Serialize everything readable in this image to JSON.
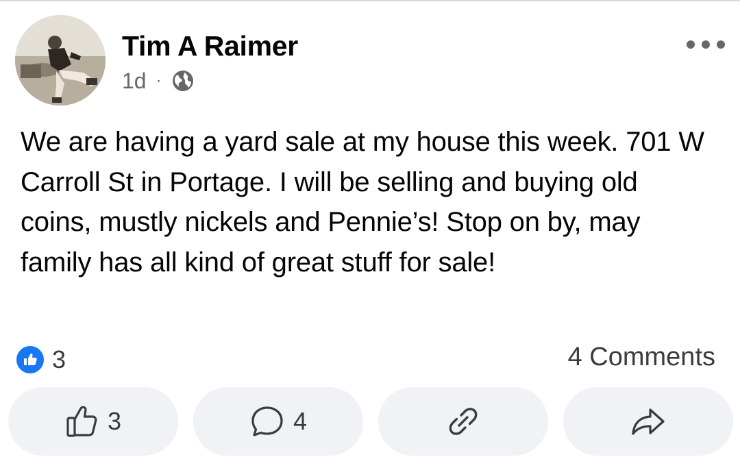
{
  "post": {
    "author": "Tim A Raimer",
    "time": "1d",
    "separator": "·",
    "privacy_icon": "globe-icon",
    "menu_icon": "more-dots-icon",
    "text": "We are having a yard sale at my house this week. 701 W Carroll St in Portage. I will be selling and buying old coins, mustly nickels and Pennie’s! Stop on by, may family has all kind of great stuff for sale!",
    "reaction_icon": "like-reaction-icon",
    "reaction_count": "3",
    "comments_summary": "4 Comments"
  },
  "actions": {
    "like": {
      "icon": "thumbs-up-icon",
      "count": "3"
    },
    "comment": {
      "icon": "comment-bubble-icon",
      "count": "4"
    },
    "copy_link": {
      "icon": "link-icon"
    },
    "share": {
      "icon": "share-arrow-icon"
    }
  },
  "colors": {
    "accent": "#1877f2",
    "secondary_text": "#65676b",
    "button_bg": "#f0f2f5"
  }
}
